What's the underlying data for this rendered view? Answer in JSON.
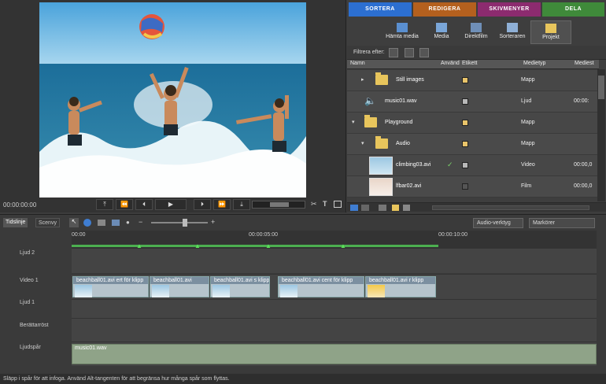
{
  "monitor": {
    "timecode": "00:00:00:00"
  },
  "transport": [
    "⤒",
    "⏪",
    "⏴",
    "▶",
    "⏵",
    "⏩",
    "⤓"
  ],
  "top_tabs": [
    {
      "label": "SORTERA",
      "color": "#2c6fd1"
    },
    {
      "label": "REDIGERA",
      "color": "#b4601e"
    },
    {
      "label": "SKIVMENYER",
      "color": "#8c2b6f"
    },
    {
      "label": "DELA",
      "color": "#3f8a3a"
    }
  ],
  "sub_tabs": [
    "Hämta media",
    "Media",
    "Direktfilm",
    "Sorteraren",
    "Projekt"
  ],
  "filter_label": "Filtrera efter:",
  "columns": [
    "Namn",
    "Använd",
    "Etikett",
    "Medietyp",
    "Mediest"
  ],
  "rows": [
    {
      "name": "Still images",
      "type": "Mapp",
      "dur": ""
    },
    {
      "name": "music01.wav",
      "type": "Ljud",
      "dur": "00:00:"
    },
    {
      "name": "Playground",
      "type": "Mapp",
      "dur": ""
    },
    {
      "name": "Audio",
      "type": "Mapp",
      "dur": ""
    },
    {
      "name": "climbing03.avi",
      "type": "Video",
      "dur": "00:00,0"
    },
    {
      "name": "lfbar02.avi",
      "type": "Film",
      "dur": "00:00,0"
    }
  ],
  "timeline": {
    "tabs": [
      "Tidslinje",
      "Scenvy"
    ],
    "dropdowns": [
      "Audio-verktyg",
      "Markörer"
    ],
    "ruler": [
      "00:00",
      "00:00:05:00",
      "00:00:10:00"
    ],
    "tracks": [
      "Ljud 2",
      "Video 1",
      "Ljud 1",
      "Berättarröst",
      "Ljudspår"
    ],
    "clips": [
      "beachball01.avi  ert för klipp",
      "beachball01.avi",
      "beachball01.avi  s klipp",
      "beachball01.avi  cent för klipp",
      "beachball01.avi  r klipp"
    ],
    "audio_clip": "music01.wav"
  },
  "status": "Släpp i spår för att infoga. Använd Alt-tangenten för att begränsa hur många spår som flyttas."
}
